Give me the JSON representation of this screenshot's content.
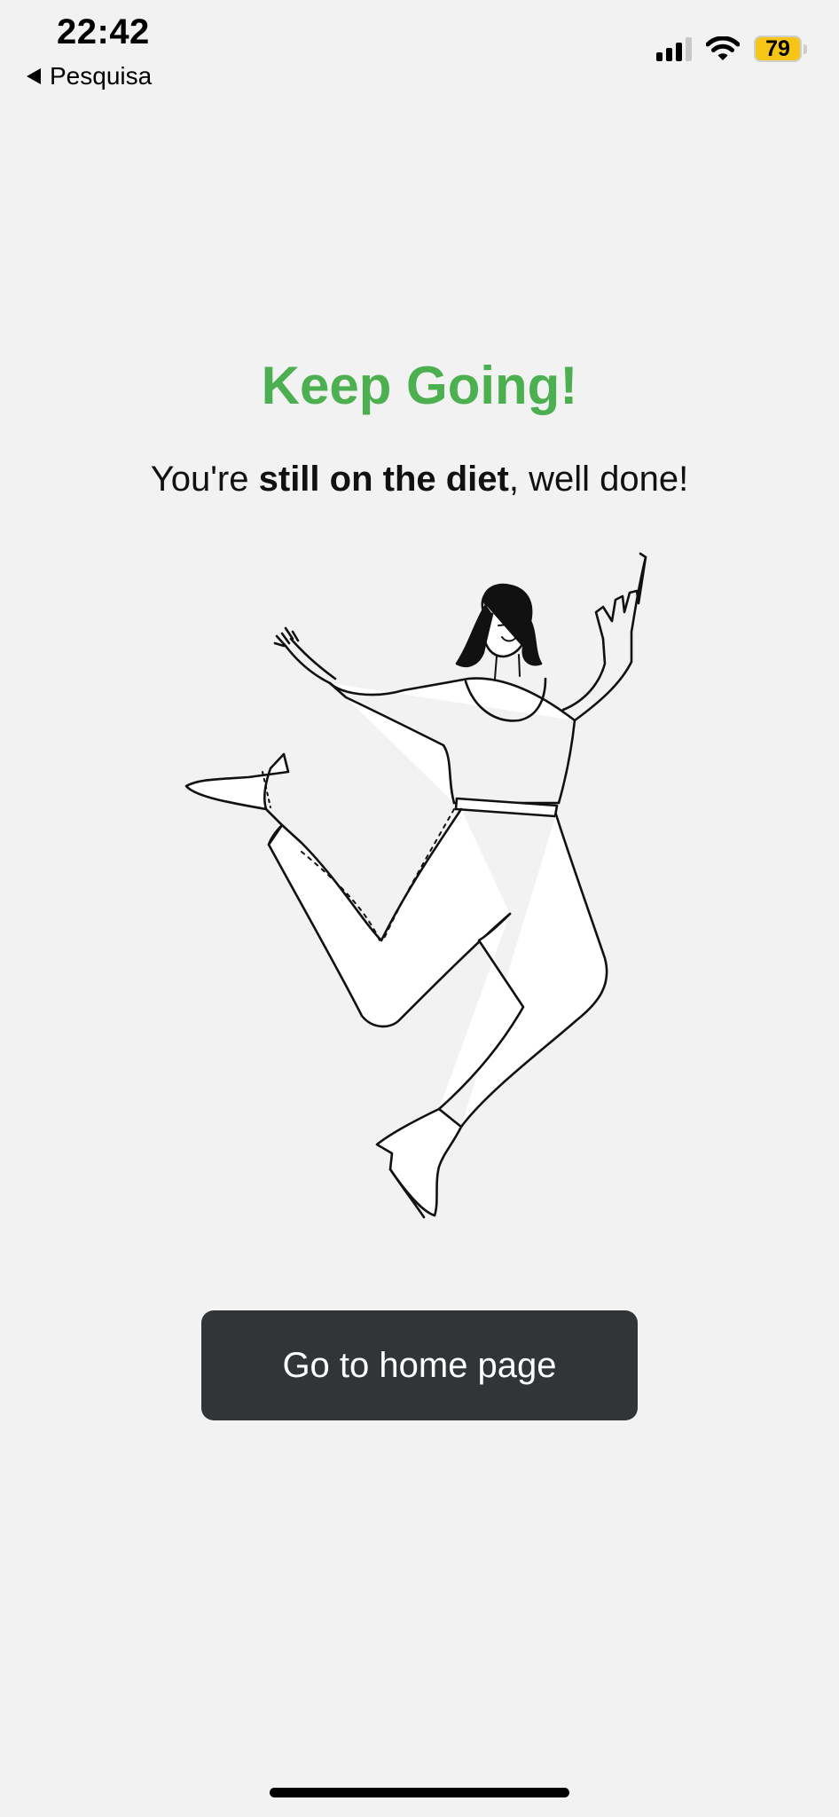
{
  "status_bar": {
    "time": "22:42",
    "back_label": "Pesquisa",
    "battery_level": "79",
    "signal_bars_active": 3,
    "icons": [
      "signal-icon",
      "wifi-icon",
      "battery-icon"
    ]
  },
  "content": {
    "title": "Keep Going!",
    "subtitle_prefix": "You're ",
    "subtitle_bold": "still on the diet",
    "subtitle_suffix": ", well done!",
    "illustration": "jumping-woman-illustration"
  },
  "actions": {
    "home_button_label": "Go to home page"
  },
  "colors": {
    "background": "#f2f2f2",
    "title_green": "#4caf50",
    "button_bg": "#323538",
    "button_text": "#ffffff",
    "battery_yellow": "#f5c518"
  }
}
